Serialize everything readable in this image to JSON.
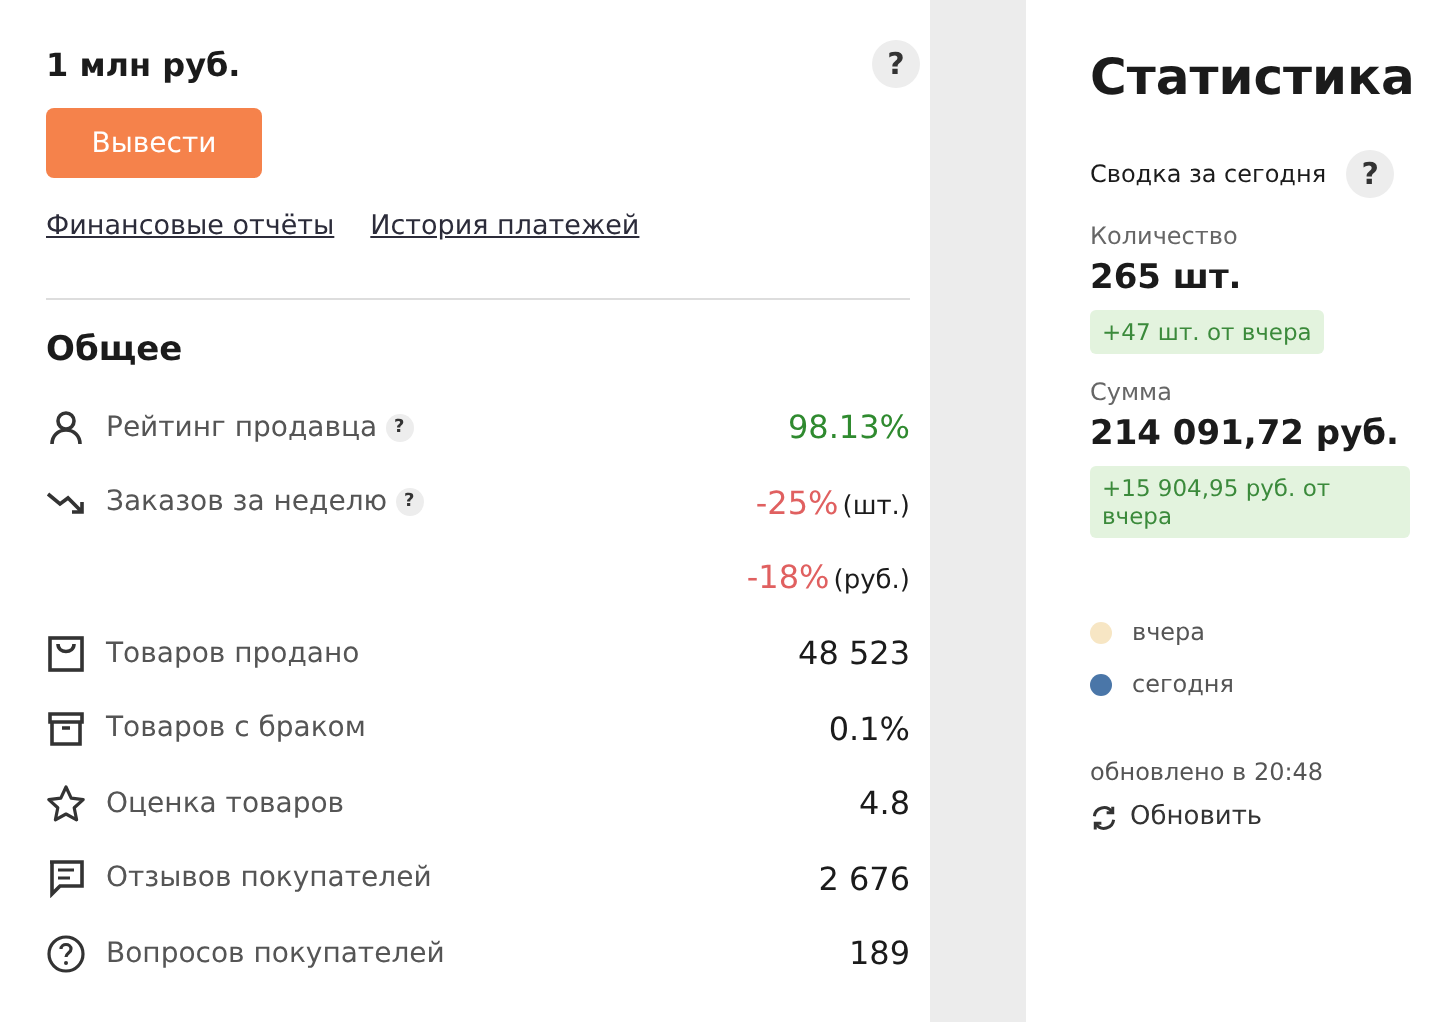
{
  "balance": {
    "amount": "1 млн руб.",
    "help": "?",
    "button": "Вывести",
    "links": [
      "Финансовые отчёты",
      "История платежей"
    ]
  },
  "general": {
    "title": "Общее",
    "rows": [
      {
        "label": "Рейтинг продавца",
        "help": "?",
        "values": [
          {
            "value": "98.13%",
            "color": "#2f8a2f"
          }
        ]
      },
      {
        "label": "Заказов за неделю",
        "help": "?",
        "values": [
          {
            "value": "-25%",
            "unit": "(шт.)",
            "color": "#e06060"
          },
          {
            "value": "-18%",
            "unit": "(руб.)",
            "color": "#e06060"
          }
        ]
      },
      {
        "label": "Товаров продано",
        "values": [
          {
            "value": "48 523",
            "color": "#1b1b1b"
          }
        ]
      },
      {
        "label": "Товаров с браком",
        "values": [
          {
            "value": "0.1%",
            "color": "#1b1b1b"
          }
        ]
      },
      {
        "label": "Оценка товаров",
        "values": [
          {
            "value": "4.8",
            "color": "#1b1b1b"
          }
        ]
      },
      {
        "label": "Отзывов покупателей",
        "values": [
          {
            "value": "2 676",
            "color": "#1b1b1b"
          }
        ]
      },
      {
        "label": "Вопросов покупателей",
        "values": [
          {
            "value": "189",
            "color": "#1b1b1b"
          }
        ]
      }
    ]
  },
  "statistics": {
    "title": "Статистика",
    "summary": "Сводка за сегодня",
    "help": "?",
    "metrics": [
      {
        "label": "Количество",
        "value": "265 шт.",
        "delta": "+47 шт. от вчера"
      },
      {
        "label": "Сумма",
        "value": "214 091,72 руб.",
        "delta": "+15 904,95 руб. от вчера"
      }
    ],
    "legend": [
      {
        "label": "вчера",
        "color": "#f7e6c4"
      },
      {
        "label": "сегодня",
        "color": "#4a76a8"
      }
    ],
    "updated": "обновлено в 20:48",
    "refresh": "Обновить"
  }
}
